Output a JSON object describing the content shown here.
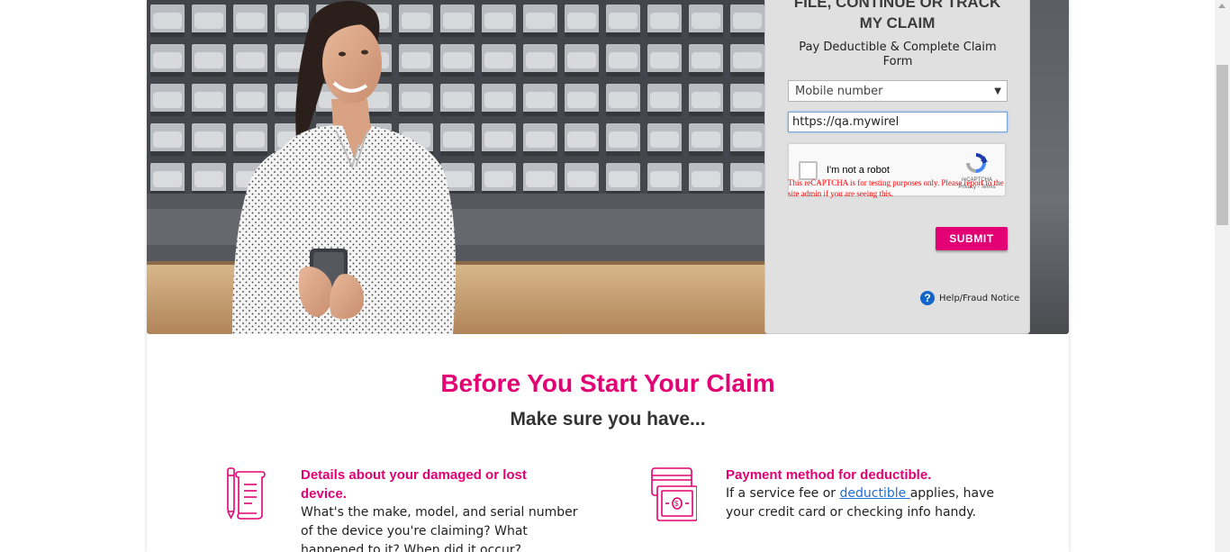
{
  "claim_panel": {
    "title_line1": "FILE, CONTINUE OR TRACK",
    "title_line2": "MY CLAIM",
    "subtitle": "Pay Deductible & Complete Claim Form",
    "lookup_type": "Mobile number",
    "lookup_value": "https://qa.mywirel",
    "recaptcha_label": "I'm not a robot",
    "recaptcha_brand": "reCAPTCHA",
    "recaptcha_terms": "Privacy - Terms",
    "recaptcha_warning": "This reCAPTCHA is for testing purposes only. Please report to the site admin if you are seeing this.",
    "submit_label": "SUBMIT",
    "help_label": "Help/Fraud Notice"
  },
  "section": {
    "title": "Before You Start Your Claim",
    "subtitle": "Make sure you have..."
  },
  "requirements": [
    {
      "icon": "document-pen-icon",
      "title": "Details about your damaged or lost device.",
      "text": "What's the make, model, and serial number of the device you're claiming? What happened to it? When did it occur?"
    },
    {
      "icon": "payment-card-icon",
      "title": "Payment method for deductible.",
      "text_before": "If a service fee or ",
      "link": "deductible ",
      "text_after": "applies, have your credit card or checking info handy."
    }
  ],
  "colors": {
    "brand": "#e20074",
    "link": "#1f6fd0",
    "panel_bg": "#e0e0e0"
  }
}
